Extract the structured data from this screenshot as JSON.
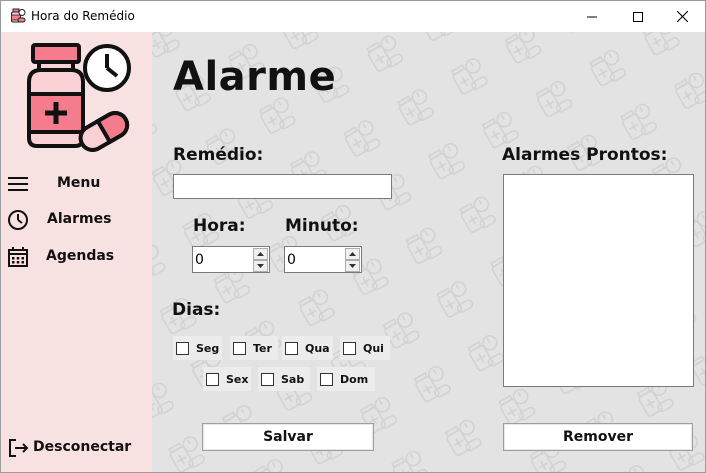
{
  "window": {
    "title": "Hora do Remédio",
    "controls": {
      "minimize": "minimize-icon",
      "maximize": "maximize-icon",
      "close": "close-icon"
    }
  },
  "sidebar": {
    "items": [
      {
        "label": "Menu",
        "icon": "hamburger-menu-icon"
      },
      {
        "label": "Alarmes",
        "icon": "clock-icon"
      },
      {
        "label": "Agendas",
        "icon": "calendar-icon"
      }
    ],
    "logout": {
      "label": "Desconectar",
      "icon": "logout-icon"
    },
    "logo": "medicine-bottle-clock-icon"
  },
  "main": {
    "title": "Alarme",
    "remedio": {
      "label": "Remédio:",
      "value": ""
    },
    "hora": {
      "label": "Hora:",
      "value": "0"
    },
    "minuto": {
      "label": "Minuto:",
      "value": "0"
    },
    "dias": {
      "label": "Dias:",
      "days": [
        {
          "label": "Seg",
          "checked": false
        },
        {
          "label": "Ter",
          "checked": false
        },
        {
          "label": "Qua",
          "checked": false
        },
        {
          "label": "Qui",
          "checked": false
        },
        {
          "label": "Sex",
          "checked": false
        },
        {
          "label": "Sab",
          "checked": false
        },
        {
          "label": "Dom",
          "checked": false
        }
      ]
    },
    "prontos": {
      "label": "Alarmes Prontos:",
      "items": []
    },
    "buttons": {
      "salvar": "Salvar",
      "remover": "Remover"
    }
  },
  "colors": {
    "sidebar_bg": "#f8e1e1",
    "main_bg": "#e3e3e3",
    "logo_pink": "#f47c8c",
    "logo_light": "#f9d0d3"
  }
}
